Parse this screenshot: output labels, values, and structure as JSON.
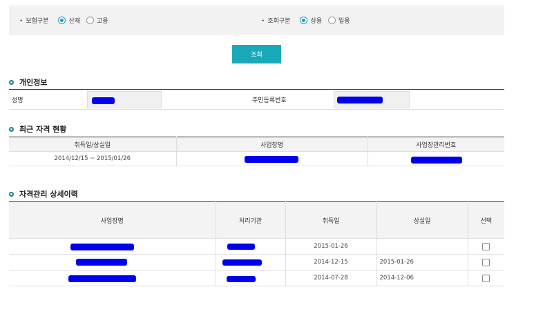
{
  "filters": {
    "insurance": {
      "label": "보험구분",
      "options": [
        {
          "label": "산재",
          "selected": true
        },
        {
          "label": "고용",
          "selected": false
        }
      ]
    },
    "inquiry": {
      "label": "조회구분",
      "options": [
        {
          "label": "상용",
          "selected": true
        },
        {
          "label": "일용",
          "selected": false
        }
      ]
    }
  },
  "search_button": "조회",
  "personal": {
    "title": "개인정보",
    "name_label": "성명",
    "rrn_label": "주민등록번호"
  },
  "current": {
    "title": "최근 자격 현황",
    "headers": [
      "취득일/상실일",
      "사업장명",
      "사업장관리번호"
    ],
    "row": {
      "dates": "2014/12/15 ~ 2015/01/26"
    }
  },
  "detail": {
    "title": "자격관리 상세이력",
    "headers": [
      "사업장명",
      "처리기관",
      "취득일",
      "상실일",
      "선택"
    ],
    "rows": [
      {
        "acquired": "2015-01-26",
        "lost": ""
      },
      {
        "acquired": "2014-12-15",
        "lost": "2015-01-26"
      },
      {
        "acquired": "2014-07-28",
        "lost": "2014-12-06"
      }
    ]
  },
  "colors": {
    "accent": "#1aa9b8",
    "redaction": "#0000ee"
  }
}
